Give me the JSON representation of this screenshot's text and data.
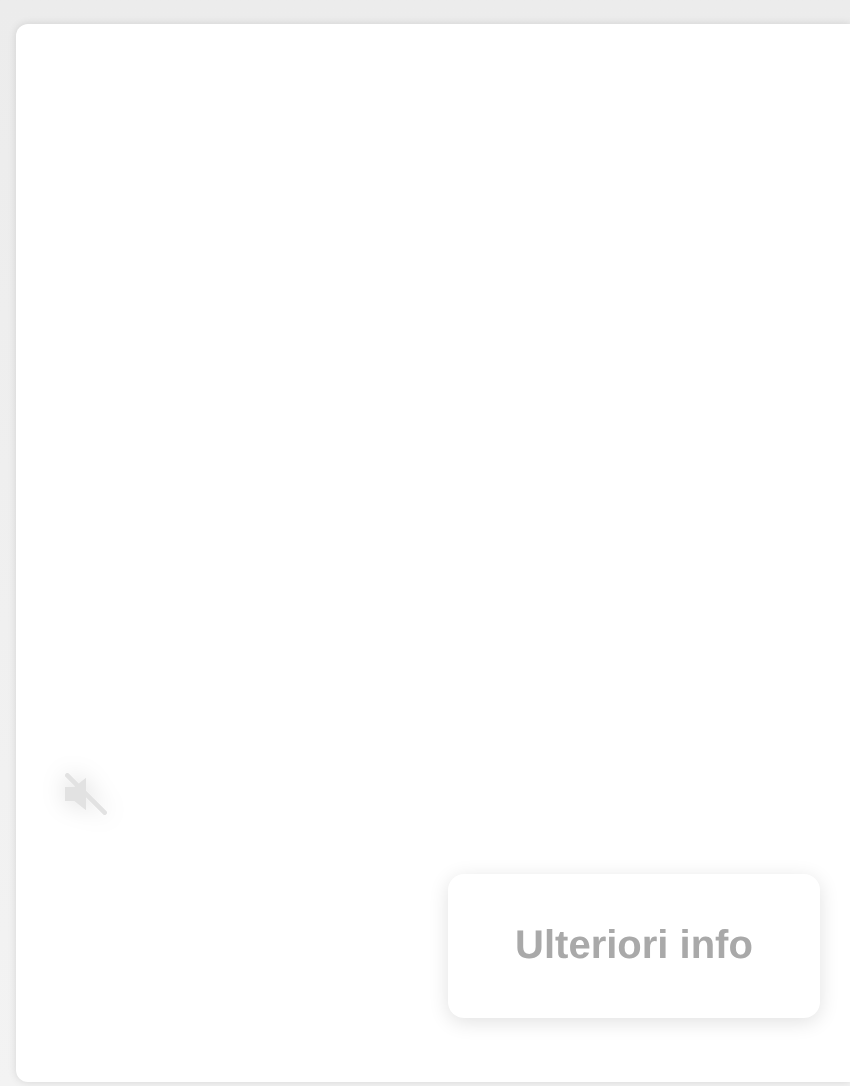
{
  "mute_button": {
    "muted": true
  },
  "more_info_button": {
    "label": "Ulteriori info"
  }
}
